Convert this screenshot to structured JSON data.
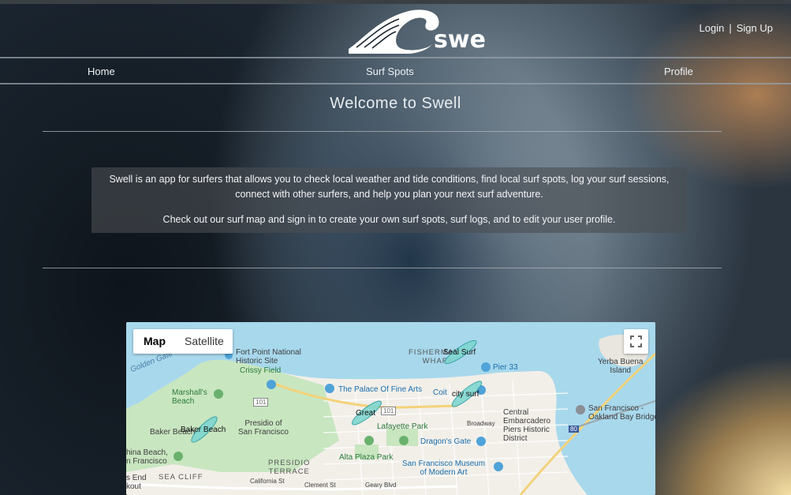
{
  "app": {
    "name": "swell"
  },
  "colors": {
    "accent": "#ffffff",
    "spot_fill": "#7fd6d0",
    "water": "#a8d8ec",
    "park": "#c8e6c0"
  },
  "auth": {
    "login": "Login",
    "separator": "|",
    "signup": "Sign Up"
  },
  "nav": {
    "home": "Home",
    "surf_spots": "Surf Spots",
    "profile": "Profile"
  },
  "page": {
    "title": "Welcome to Swell",
    "intro_line1": "Swell is an app for surfers that allows you to check local weather and tide conditions, find local surf spots, log your surf sessions, connect with other surfers, and help you plan your next surf adventure.",
    "intro_line2": "Check out our surf map and sign in to create your own surf spots, surf logs, and to edit your user profile."
  },
  "map": {
    "type_controls": {
      "map": "Map",
      "satellite": "Satellite",
      "selected": "Map"
    },
    "fullscreen_icon": "fullscreen-icon",
    "places": {
      "fort_point": "Fort Point National\nHistoric Site",
      "crissy_field": "Crissy Field",
      "golden_gate": "Golden Gate",
      "marshalls": "Marshall's\nBeach",
      "presidio": "Presidio of\nSan Francisco",
      "palace": "The Palace Of Fine Arts",
      "fishermans_wharf": "FISHERMAN'S\nWHARF",
      "pier_33": "Pier 33",
      "coit": "Coit",
      "lafayette": "Lafayette Park",
      "alta_plaza": "Alta Plaza Park",
      "dragons_gate": "Dragon's Gate",
      "central_embarcadero": "Central\nEmbarcadero\nPiers Historic\nDistrict",
      "sf_museum": "San Francisco Museum\nof Modern Art",
      "sf_oakland_bridge": "San Francisco -\nOakland Bay Bridge",
      "yerba_buena": "Yerba Buena\nIsland",
      "china_beach": "hina Beach,\nn Francisco",
      "baker_beach_place": "Baker Beach",
      "sea_cliff": "SEA CLIFF",
      "presidio_terrace": "PRESIDIO\nTERRACE",
      "lands_end": "s End\nkout",
      "geary": "Geary Blvd",
      "california": "California St",
      "clement": "Clement St",
      "broadway": "Broadway",
      "route_101a": "101",
      "route_101b": "101",
      "route_80": "80"
    },
    "surf_spots": [
      {
        "label": "Seal Surf"
      },
      {
        "label": "city surf"
      },
      {
        "label": "Great"
      },
      {
        "label": "Baker Beach"
      }
    ]
  }
}
